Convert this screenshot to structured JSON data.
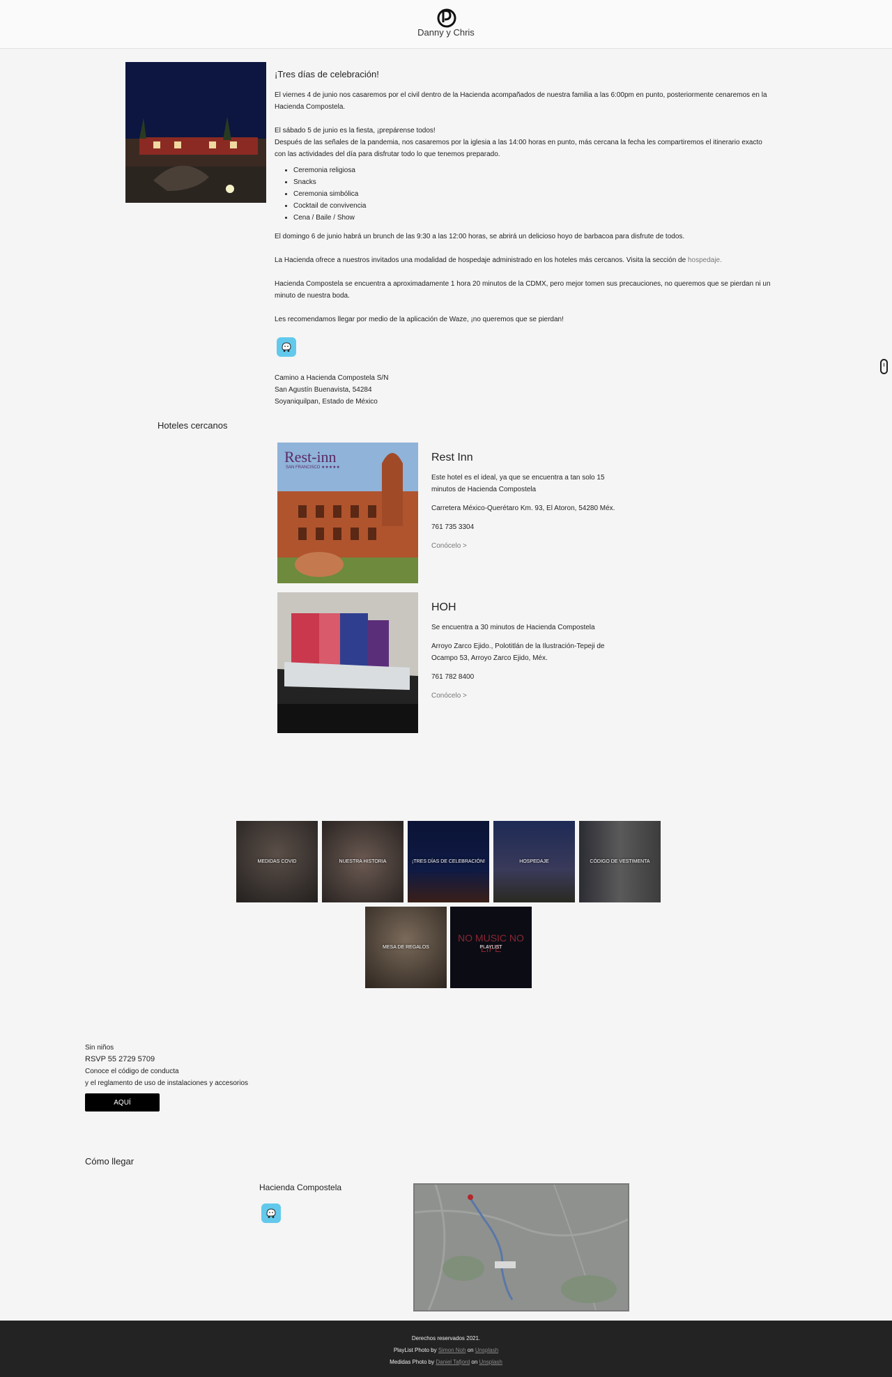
{
  "header": {
    "brand": "Danny y Chris",
    "logo_icon": "dc-monogram-icon"
  },
  "intro": {
    "title": "¡Tres días de celebración!",
    "p1": "El viernes 4 de junio nos casaremos por el civil dentro de la Hacienda acompañados de nuestra familia a las 6:00pm en punto, posteriormente cenaremos en la Hacienda Compostela.",
    "p2a": "El sábado 5 de junio es la fiesta, ¡prepárense todos!",
    "p2b": "Después de las señales de la pandemia, nos casaremos por la iglesia a las 14:00 horas en punto, más cercana la fecha les compartiremos el itinerario exacto con las actividades del día para disfrutar todo lo que tenemos preparado.",
    "schedule": [
      "Ceremonia religiosa",
      "Snacks",
      "Ceremonia simbólica",
      "Cocktail de convivencia",
      "Cena / Baile / Show"
    ],
    "p3": "El domingo 6 de junio habrá un brunch de las 9:30 a las 12:00 horas, se abrirá un delicioso hoyo de barbacoa para disfrute de todos.",
    "p4_text": "La Hacienda ofrece a nuestros invitados una modalidad de hospedaje administrado en los hoteles más cercanos. Visita la sección de",
    "p4_link": "hospedaje.",
    "p5": "Hacienda Compostela se encuentra a aproximadamente 1 hora 20 minutos de la CDMX, pero mejor tomen sus precauciones, no queremos que se pierdan ni un minuto de nuestra boda.",
    "p6": "Les recomendamos llegar por medio de la aplicación de Waze, ¡no queremos que se pierdan!",
    "waze_icon": "waze-icon",
    "address": [
      "Camino a Hacienda Compostela S/N",
      "San Agustín Buenavista, 54284",
      "Soyaniquilpan, Estado de México"
    ]
  },
  "hotels": {
    "title": "Hoteles cercanos",
    "items": [
      {
        "name": "Rest Inn",
        "logo_text": "Rest-inn",
        "logo_sub": "SAN FRANCISCO ★★★★★",
        "desc": "Este hotel es el ideal, ya que se encuentra a tan solo 15 minutos de Hacienda Compostela",
        "address": "Carretera México-Querétaro Km. 93, El Atoron, 54280 Méx.",
        "phone": "761 735 3304",
        "link": "Conócelo >"
      },
      {
        "name": "HOH",
        "desc": "Se encuentra a 30 minutos de Hacienda Compostela",
        "address": "Arroyo Zarco Ejido., Polotitlán de la Ilustración-Tepeji de Ocampo 53, Arroyo Zarco Ejido, Méx.",
        "phone": "761 782 8400",
        "link": "Conócelo >"
      }
    ]
  },
  "tiles": [
    {
      "label": "MEDIDAS COVID"
    },
    {
      "label": "NUESTRA HISTORIA"
    },
    {
      "label": "¡TRES DÍAS DE CELEBRACIÓN!"
    },
    {
      "label": "HOSPEDAJE"
    },
    {
      "label": "CÓDIGO DE VESTIMENTA"
    },
    {
      "label": "MESA DE REGALOS"
    },
    {
      "label": "PLAYLIST",
      "neon_text": "NO MUSIC NO LIFE"
    }
  ],
  "notes": {
    "no_kids": "Sin niños",
    "rsvp": "RSVP 55 2729 5709",
    "conduct": "Conoce el código de conducta",
    "rules": "y el reglamento de uso de instalaciones y accesorios",
    "button": "AQUÍ"
  },
  "directions": {
    "title": "Cómo llegar",
    "venue": "Hacienda Compostela",
    "waze_icon": "waze-icon",
    "map_icon": "map-pin-icon"
  },
  "footer": {
    "rights": "Derechos reservados 2021.",
    "credit1_prefix": "PlayList Photo by",
    "credit1_author": "Simon Noh",
    "credit_on": "on",
    "credit_site": "Unsplash",
    "credit2_prefix": "Medidas Photo by",
    "credit2_author": "Daniel Tafjord"
  },
  "colors": {
    "background": "#f5f5f5",
    "footer": "#232323",
    "waze": "#62c9ec",
    "button": "#000000"
  }
}
